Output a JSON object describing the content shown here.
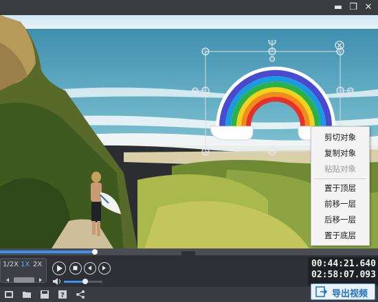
{
  "window": {
    "minimize_symbol": "▬",
    "restore_symbol": "❐",
    "close_symbol": "✕"
  },
  "context_menu": {
    "items": [
      {
        "label": "剪切对象",
        "enabled": true
      },
      {
        "label": "复制对象",
        "enabled": true
      },
      {
        "label": "粘贴对象",
        "enabled": false
      },
      {
        "label": "置于顶层",
        "enabled": true
      },
      {
        "label": "前移一层",
        "enabled": true
      },
      {
        "label": "后移一层",
        "enabled": true
      },
      {
        "label": "置于底层",
        "enabled": true
      }
    ]
  },
  "playback": {
    "speeds": [
      "1/2X",
      "1X",
      "2X"
    ],
    "active_speed": "1X",
    "current_time": "00:44:21.640",
    "total_time": "02:58:07.093",
    "progress": 0.25,
    "volume": 0.55
  },
  "toolbar": {
    "icons": [
      "media-icon",
      "open-folder-icon",
      "save-icon",
      "help-icon",
      "share-icon"
    ],
    "export_label": "导出视频"
  },
  "colors": {
    "accent": "#3d8ff0",
    "timeline_fill": "#3d8ff0",
    "export_text": "#1e6fc8"
  }
}
